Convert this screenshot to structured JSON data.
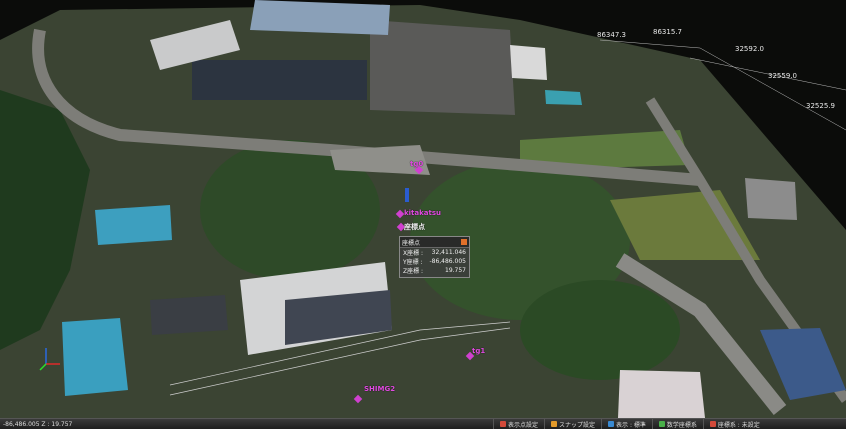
{
  "scene": {
    "coords": [
      "86347.3",
      "86315.7",
      "32592.0",
      "32559.0",
      "32525.9"
    ],
    "markers": [
      {
        "label": "tg0"
      },
      {
        "label": "kitakatsu"
      },
      {
        "label": "座標点"
      },
      {
        "label": "tg1"
      },
      {
        "label": "SHIMG2"
      }
    ]
  },
  "info_panel": {
    "title": "座標点",
    "rows": [
      {
        "label": "X座標 :",
        "value": "32,411.046"
      },
      {
        "label": "Y座標 :",
        "value": "-86,486.005"
      },
      {
        "label": "Z座標 :",
        "value": "19.757"
      }
    ]
  },
  "statusbar": {
    "cursor_readout": "-86,486.005  Z : 19.757",
    "buttons": [
      {
        "label": "表示点設定",
        "icon": "display-points-icon",
        "color": "#d24a3a"
      },
      {
        "label": "スナップ設定",
        "icon": "snap-icon",
        "color": "#e39a2a"
      },
      {
        "label": "表示 : 標準",
        "icon": "display-mode-icon",
        "color": "#3a8ad2"
      },
      {
        "label": "数学座標系",
        "icon": "coordinate-system-icon",
        "color": "#4ab04a"
      },
      {
        "label": "座標系 : 未設定",
        "icon": "crs-icon",
        "color": "#d24a3a"
      }
    ]
  }
}
